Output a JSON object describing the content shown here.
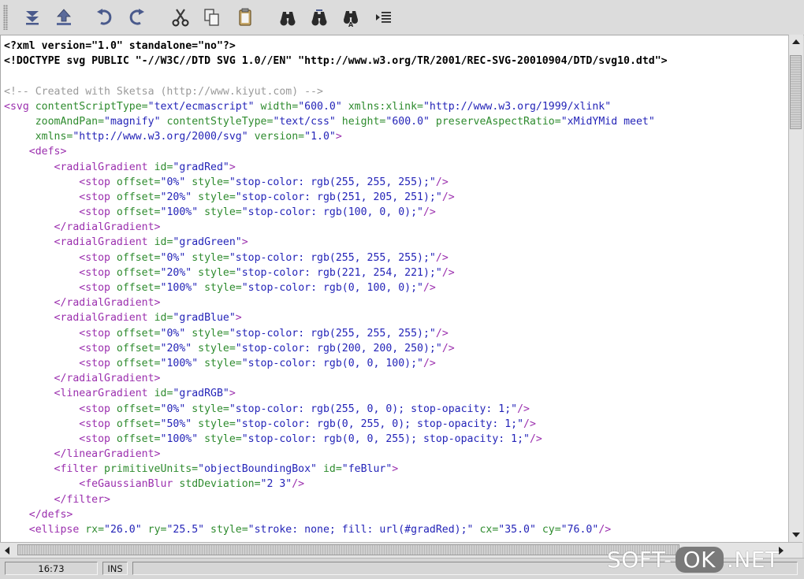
{
  "toolbar": {
    "buttons": [
      {
        "name": "collapse-all-button",
        "icon": "collapse-arrows-icon",
        "label": "Collapse"
      },
      {
        "name": "expand-button",
        "icon": "up-arrow-icon",
        "label": "Up"
      },
      {
        "name": "undo-button",
        "icon": "undo-icon",
        "label": "Undo"
      },
      {
        "name": "redo-button",
        "icon": "redo-icon",
        "label": "Redo"
      },
      {
        "name": "cut-button",
        "icon": "scissors-icon",
        "label": "Cut"
      },
      {
        "name": "copy-button",
        "icon": "copy-icon",
        "label": "Copy"
      },
      {
        "name": "paste-button",
        "icon": "clipboard-icon",
        "label": "Paste"
      },
      {
        "name": "find-button",
        "icon": "binoculars-icon",
        "label": "Find"
      },
      {
        "name": "find-next-button",
        "icon": "binoculars-next-icon",
        "label": "Find Next"
      },
      {
        "name": "replace-button",
        "icon": "binoculars-replace-icon",
        "label": "Replace"
      },
      {
        "name": "goto-line-button",
        "icon": "goto-line-icon",
        "label": "Go To Line"
      }
    ]
  },
  "editor": {
    "lines": [
      [
        {
          "c": "pi",
          "t": "<?xml version=\"1.0\" standalone=\"no\"?>"
        }
      ],
      [
        {
          "c": "doctype",
          "t": "<!DOCTYPE svg PUBLIC \"-//W3C//DTD SVG 1.0//EN\" \"http://www.w3.org/TR/2001/REC-SVG-20010904/DTD/svg10.dtd\">"
        }
      ],
      [],
      [
        {
          "c": "comment",
          "t": "<!-- Created with Sketsa (http://www.kiyut.com) -->"
        }
      ],
      [
        {
          "c": "tag",
          "t": "<svg"
        },
        {
          "c": "attr",
          "t": " contentScriptType="
        },
        {
          "c": "val",
          "t": "\"text/ecmascript\""
        },
        {
          "c": "attr",
          "t": " width="
        },
        {
          "c": "val",
          "t": "\"600.0\""
        },
        {
          "c": "attr",
          "t": " xmlns:xlink="
        },
        {
          "c": "val",
          "t": "\"http://www.w3.org/1999/xlink\""
        }
      ],
      [
        {
          "c": "attr",
          "t": "     zoomAndPan="
        },
        {
          "c": "val",
          "t": "\"magnify\""
        },
        {
          "c": "attr",
          "t": " contentStyleType="
        },
        {
          "c": "val",
          "t": "\"text/css\""
        },
        {
          "c": "attr",
          "t": " height="
        },
        {
          "c": "val",
          "t": "\"600.0\""
        },
        {
          "c": "attr",
          "t": " preserveAspectRatio="
        },
        {
          "c": "val",
          "t": "\"xMidYMid meet\""
        }
      ],
      [
        {
          "c": "attr",
          "t": "     xmlns="
        },
        {
          "c": "val",
          "t": "\"http://www.w3.org/2000/svg\""
        },
        {
          "c": "attr",
          "t": " version="
        },
        {
          "c": "val",
          "t": "\"1.0\""
        },
        {
          "c": "tag",
          "t": ">"
        }
      ],
      [
        {
          "c": "tag",
          "t": "    <defs>"
        }
      ],
      [
        {
          "c": "tag",
          "t": "        <radialGradient"
        },
        {
          "c": "attr",
          "t": " id="
        },
        {
          "c": "val",
          "t": "\"gradRed\""
        },
        {
          "c": "tag",
          "t": ">"
        }
      ],
      [
        {
          "c": "tag",
          "t": "            <stop"
        },
        {
          "c": "attr",
          "t": " offset="
        },
        {
          "c": "val",
          "t": "\"0%\""
        },
        {
          "c": "attr",
          "t": " style="
        },
        {
          "c": "val",
          "t": "\"stop-color: rgb(255, 255, 255);\""
        },
        {
          "c": "tag",
          "t": "/>"
        }
      ],
      [
        {
          "c": "tag",
          "t": "            <stop"
        },
        {
          "c": "attr",
          "t": " offset="
        },
        {
          "c": "val",
          "t": "\"20%\""
        },
        {
          "c": "attr",
          "t": " style="
        },
        {
          "c": "val",
          "t": "\"stop-color: rgb(251, 205, 251);\""
        },
        {
          "c": "tag",
          "t": "/>"
        }
      ],
      [
        {
          "c": "tag",
          "t": "            <stop"
        },
        {
          "c": "attr",
          "t": " offset="
        },
        {
          "c": "val",
          "t": "\"100%\""
        },
        {
          "c": "attr",
          "t": " style="
        },
        {
          "c": "val",
          "t": "\"stop-color: rgb(100, 0, 0);\""
        },
        {
          "c": "tag",
          "t": "/>"
        }
      ],
      [
        {
          "c": "tag",
          "t": "        </radialGradient>"
        }
      ],
      [
        {
          "c": "tag",
          "t": "        <radialGradient"
        },
        {
          "c": "attr",
          "t": " id="
        },
        {
          "c": "val",
          "t": "\"gradGreen\""
        },
        {
          "c": "tag",
          "t": ">"
        }
      ],
      [
        {
          "c": "tag",
          "t": "            <stop"
        },
        {
          "c": "attr",
          "t": " offset="
        },
        {
          "c": "val",
          "t": "\"0%\""
        },
        {
          "c": "attr",
          "t": " style="
        },
        {
          "c": "val",
          "t": "\"stop-color: rgb(255, 255, 255);\""
        },
        {
          "c": "tag",
          "t": "/>"
        }
      ],
      [
        {
          "c": "tag",
          "t": "            <stop"
        },
        {
          "c": "attr",
          "t": " offset="
        },
        {
          "c": "val",
          "t": "\"20%\""
        },
        {
          "c": "attr",
          "t": " style="
        },
        {
          "c": "val",
          "t": "\"stop-color: rgb(221, 254, 221);\""
        },
        {
          "c": "tag",
          "t": "/>"
        }
      ],
      [
        {
          "c": "tag",
          "t": "            <stop"
        },
        {
          "c": "attr",
          "t": " offset="
        },
        {
          "c": "val",
          "t": "\"100%\""
        },
        {
          "c": "attr",
          "t": " style="
        },
        {
          "c": "val",
          "t": "\"stop-color: rgb(0, 100, 0);\""
        },
        {
          "c": "tag",
          "t": "/>"
        }
      ],
      [
        {
          "c": "tag",
          "t": "        </radialGradient>"
        }
      ],
      [
        {
          "c": "tag",
          "t": "        <radialGradient"
        },
        {
          "c": "attr",
          "t": " id="
        },
        {
          "c": "val",
          "t": "\"gradBlue\""
        },
        {
          "c": "tag",
          "t": ">"
        }
      ],
      [
        {
          "c": "tag",
          "t": "            <stop"
        },
        {
          "c": "attr",
          "t": " offset="
        },
        {
          "c": "val",
          "t": "\"0%\""
        },
        {
          "c": "attr",
          "t": " style="
        },
        {
          "c": "val",
          "t": "\"stop-color: rgb(255, 255, 255);\""
        },
        {
          "c": "tag",
          "t": "/>"
        }
      ],
      [
        {
          "c": "tag",
          "t": "            <stop"
        },
        {
          "c": "attr",
          "t": " offset="
        },
        {
          "c": "val",
          "t": "\"20%\""
        },
        {
          "c": "attr",
          "t": " style="
        },
        {
          "c": "val",
          "t": "\"stop-color: rgb(200, 200, 250);\""
        },
        {
          "c": "tag",
          "t": "/>"
        }
      ],
      [
        {
          "c": "tag",
          "t": "            <stop"
        },
        {
          "c": "attr",
          "t": " offset="
        },
        {
          "c": "val",
          "t": "\"100%\""
        },
        {
          "c": "attr",
          "t": " style="
        },
        {
          "c": "val",
          "t": "\"stop-color: rgb(0, 0, 100);\""
        },
        {
          "c": "tag",
          "t": "/>"
        }
      ],
      [
        {
          "c": "tag",
          "t": "        </radialGradient>"
        }
      ],
      [
        {
          "c": "tag",
          "t": "        <linearGradient"
        },
        {
          "c": "attr",
          "t": " id="
        },
        {
          "c": "val",
          "t": "\"gradRGB\""
        },
        {
          "c": "tag",
          "t": ">"
        }
      ],
      [
        {
          "c": "tag",
          "t": "            <stop"
        },
        {
          "c": "attr",
          "t": " offset="
        },
        {
          "c": "val",
          "t": "\"0%\""
        },
        {
          "c": "attr",
          "t": " style="
        },
        {
          "c": "val",
          "t": "\"stop-color: rgb(255, 0, 0); stop-opacity: 1;\""
        },
        {
          "c": "tag",
          "t": "/>"
        }
      ],
      [
        {
          "c": "tag",
          "t": "            <stop"
        },
        {
          "c": "attr",
          "t": " offset="
        },
        {
          "c": "val",
          "t": "\"50%\""
        },
        {
          "c": "attr",
          "t": " style="
        },
        {
          "c": "val",
          "t": "\"stop-color: rgb(0, 255, 0); stop-opacity: 1;\""
        },
        {
          "c": "tag",
          "t": "/>"
        }
      ],
      [
        {
          "c": "tag",
          "t": "            <stop"
        },
        {
          "c": "attr",
          "t": " offset="
        },
        {
          "c": "val",
          "t": "\"100%\""
        },
        {
          "c": "attr",
          "t": " style="
        },
        {
          "c": "val",
          "t": "\"stop-color: rgb(0, 0, 255); stop-opacity: 1;\""
        },
        {
          "c": "tag",
          "t": "/>"
        }
      ],
      [
        {
          "c": "tag",
          "t": "        </linearGradient>"
        }
      ],
      [
        {
          "c": "tag",
          "t": "        <filter"
        },
        {
          "c": "attr",
          "t": " primitiveUnits="
        },
        {
          "c": "val",
          "t": "\"objectBoundingBox\""
        },
        {
          "c": "attr",
          "t": " id="
        },
        {
          "c": "val",
          "t": "\"feBlur\""
        },
        {
          "c": "tag",
          "t": ">"
        }
      ],
      [
        {
          "c": "tag",
          "t": "            <feGaussianBlur"
        },
        {
          "c": "attr",
          "t": " stdDeviation="
        },
        {
          "c": "val",
          "t": "\"2 3\""
        },
        {
          "c": "tag",
          "t": "/>"
        }
      ],
      [
        {
          "c": "tag",
          "t": "        </filter>"
        }
      ],
      [
        {
          "c": "tag",
          "t": "    </defs>"
        }
      ],
      [
        {
          "c": "tag",
          "t": "    <ellipse"
        },
        {
          "c": "attr",
          "t": " rx="
        },
        {
          "c": "val",
          "t": "\"26.0\""
        },
        {
          "c": "attr",
          "t": " ry="
        },
        {
          "c": "val",
          "t": "\"25.5\""
        },
        {
          "c": "attr",
          "t": " style="
        },
        {
          "c": "val",
          "t": "\"stroke: none; fill: url(#gradRed);\""
        },
        {
          "c": "attr",
          "t": " cx="
        },
        {
          "c": "val",
          "t": "\"35.0\""
        },
        {
          "c": "attr",
          "t": " cy="
        },
        {
          "c": "val",
          "t": "\"76.0\""
        },
        {
          "c": "tag",
          "t": "/>"
        }
      ]
    ]
  },
  "statusbar": {
    "position": "16:73",
    "mode": "INS",
    "message": ""
  },
  "watermark": {
    "left": "SOFT-",
    "ok": "OK",
    "right": ".NET"
  }
}
